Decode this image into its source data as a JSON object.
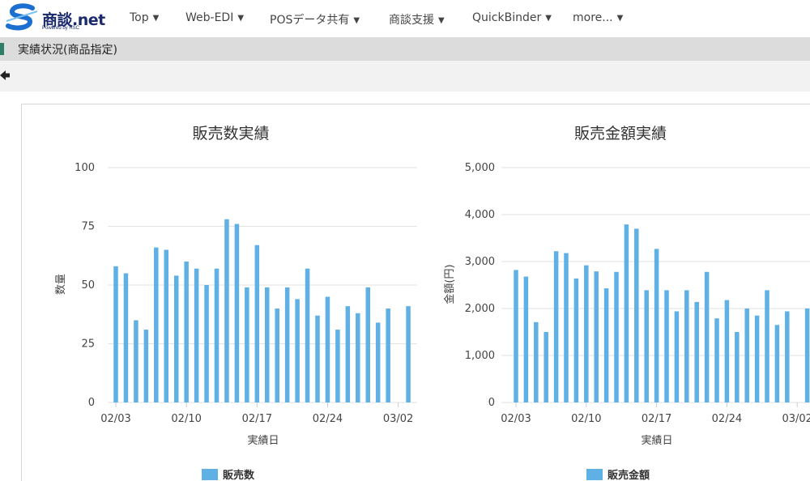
{
  "header": {
    "logo_text": "商談.net",
    "logo_sub": "Powered by RSC",
    "nav": [
      {
        "label": "Top"
      },
      {
        "label": "Web-EDI"
      },
      {
        "label": "POSデータ共有"
      },
      {
        "label": "商談支援"
      },
      {
        "label": "QuickBinder"
      },
      {
        "label": "more..."
      }
    ]
  },
  "section": {
    "title": "実績状況(商品指定)"
  },
  "colors": {
    "bar": "#5eb0e5",
    "accent": "#2e7d67",
    "brand": "#1a2a6c"
  },
  "chart_data": [
    {
      "type": "bar",
      "title": "販売数実績",
      "xlabel": "実績日",
      "ylabel": "数量",
      "ylim": [
        0,
        100
      ],
      "yticks": [
        "0",
        "25",
        "50",
        "75",
        "100"
      ],
      "xticks": [
        "02/03",
        "02/10",
        "02/17",
        "02/24",
        "03/02"
      ],
      "legend": "販売数",
      "values": [
        58,
        55,
        35,
        31,
        66,
        65,
        54,
        60,
        57,
        50,
        57,
        78,
        76,
        49,
        67,
        49,
        40,
        49,
        44,
        57,
        37,
        45,
        31,
        41,
        38,
        49,
        34,
        40,
        0,
        41
      ]
    },
    {
      "type": "bar",
      "title": "販売金額実績",
      "xlabel": "実績日",
      "ylabel": "金額(円)",
      "ylim": [
        0,
        5000
      ],
      "yticks": [
        "0",
        "1,000",
        "2,000",
        "3,000",
        "4,000",
        "5,000"
      ],
      "xticks": [
        "02/03",
        "02/10",
        "02/17",
        "02/24",
        "03/02"
      ],
      "legend": "販売金額",
      "values": [
        2820,
        2680,
        1710,
        1500,
        3220,
        3180,
        2640,
        2920,
        2790,
        2430,
        2780,
        3790,
        3700,
        2390,
        3270,
        2390,
        1940,
        2390,
        2140,
        2780,
        1790,
        2180,
        1500,
        2000,
        1850,
        2390,
        1650,
        1940,
        0,
        2000
      ]
    }
  ]
}
